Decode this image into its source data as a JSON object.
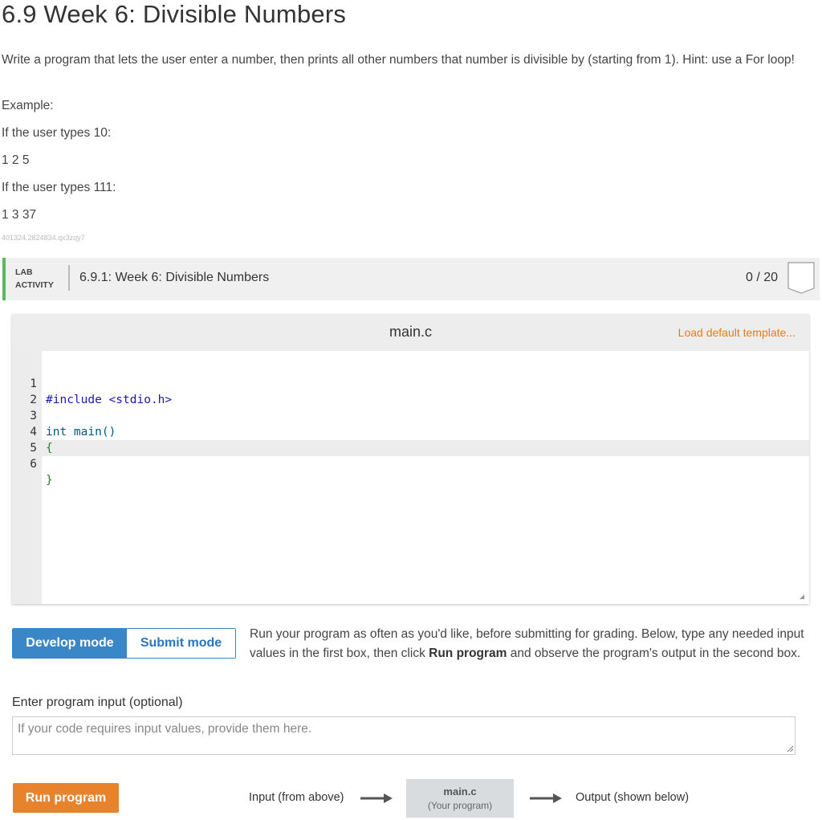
{
  "page": {
    "title": "6.9 Week 6: Divisible Numbers",
    "intro": "Write a program that lets the user enter a number, then prints all other numbers that number is divisible by (starting from 1). Hint: use a For loop!",
    "example_label": "Example:",
    "example1_prompt": "If the user types 10:",
    "example1_output": "1 2 5",
    "example2_prompt": "If the user types 111:",
    "example2_output": "1 3 37",
    "lab_id": "401324.2824834.qx3zqy7"
  },
  "lab": {
    "label_line1": "LAB",
    "label_line2": "ACTIVITY",
    "name": "6.9.1: Week 6: Divisible Numbers",
    "score": "0 / 20",
    "accent_color": "#5cb85c"
  },
  "editor": {
    "filename": "main.c",
    "load_template": "Load default template...",
    "lines": [
      {
        "num": "1",
        "text": "#include <stdio.h>"
      },
      {
        "num": "2",
        "text": ""
      },
      {
        "num": "3",
        "text": "int main()"
      },
      {
        "num": "4",
        "text": "{"
      },
      {
        "num": "5",
        "text": ""
      },
      {
        "num": "6",
        "text": "}"
      }
    ]
  },
  "modes": {
    "develop": "Develop mode",
    "submit": "Submit mode",
    "active": "develop",
    "desc_part1": "Run your program as often as you'd like, before submitting for grading. Below, type any needed input values in the first box, then click ",
    "desc_bold": "Run program",
    "desc_part2": " and observe the program's output in the second box."
  },
  "input": {
    "label": "Enter program input (optional)",
    "placeholder": "If your code requires input values, provide them here.",
    "value": ""
  },
  "run": {
    "button": "Run program",
    "flow_input": "Input (from above)",
    "program_name": "main.c",
    "program_sub": "(Your program)",
    "flow_output": "Output (shown below)",
    "accent_color": "#e8832b"
  }
}
